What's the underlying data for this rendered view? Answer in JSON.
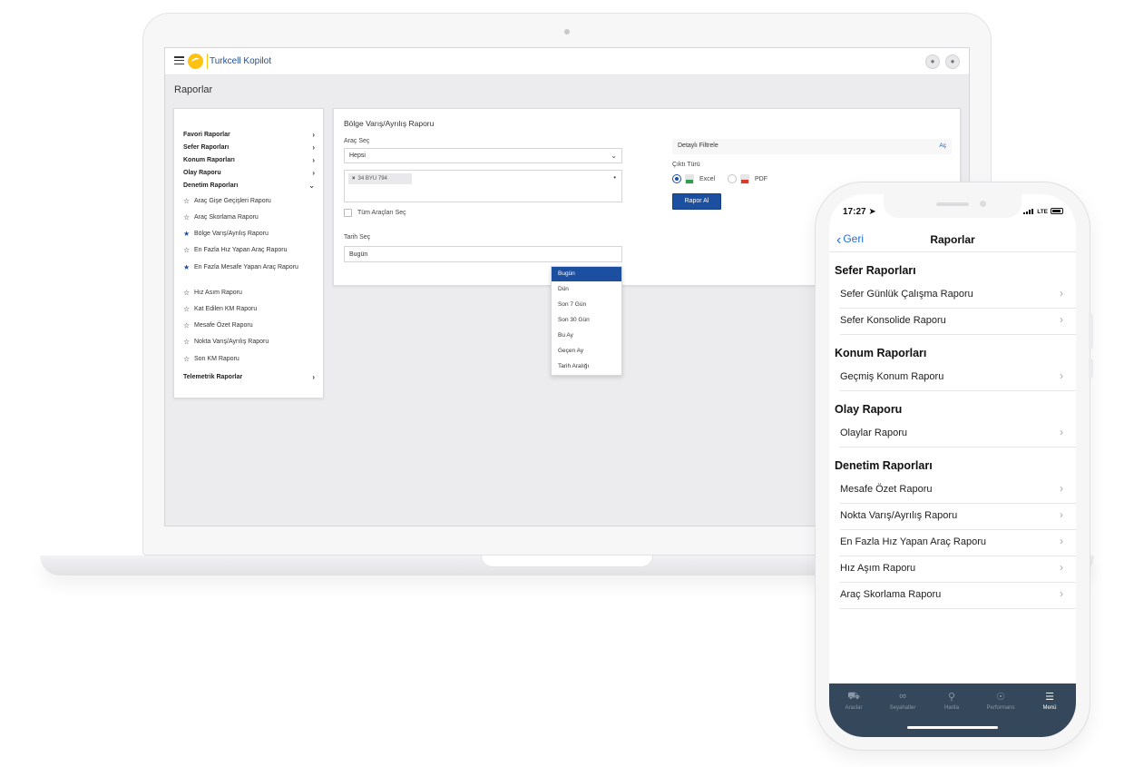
{
  "desktop": {
    "brand": "Turkcell Kopilot",
    "page_title": "Raporlar",
    "sidebar": {
      "categories": [
        {
          "label": "Favori Raporlar"
        },
        {
          "label": "Sefer Raporları"
        },
        {
          "label": "Konum Raporları"
        },
        {
          "label": "Olay Raporu"
        },
        {
          "label": "Denetim Raporları"
        },
        {
          "label": "Telemetrik Raporlar"
        }
      ],
      "denetim_items": [
        {
          "label": "Araç Gişe Geçişleri Raporu",
          "favorite": false
        },
        {
          "label": "Araç Skorlama Raporu",
          "favorite": false
        },
        {
          "label": "Bölge Varış/Ayrılış Raporu",
          "favorite": true
        },
        {
          "label": "En Fazla Hız Yapan Araç Raporu",
          "favorite": false
        },
        {
          "label": "En Fazla Mesafe Yapan Araç Raporu",
          "favorite": true
        },
        {
          "label": "Hız Asım Raporu",
          "favorite": false
        },
        {
          "label": "Kat Edilen KM Raporu",
          "favorite": false
        },
        {
          "label": "Mesafe Özet Raporu",
          "favorite": false
        },
        {
          "label": "Nokta Varış/Ayrılış Raporu",
          "favorite": false
        },
        {
          "label": "Son KM Raporu",
          "favorite": false
        }
      ]
    },
    "form": {
      "title": "Bölge Varış/Ayrılış Raporu",
      "vehicle_label": "Araç Seç",
      "vehicle_value": "Hepsi",
      "tag": "34 BYU 794",
      "select_all_label": "Tüm Araçları Seç",
      "date_label": "Tarih Seç",
      "date_value": "Bugün",
      "filter_label": "Detaylı Filtrele",
      "filter_action": "Aç",
      "output_label": "Çıktı Türü",
      "output_excel": "Excel",
      "output_pdf": "PDF",
      "submit": "Rapor Al"
    },
    "date_options": [
      "Bugün",
      "Dün",
      "Son 7 Gün",
      "Son 30 Gün",
      "Bu Ay",
      "Geçen Ay",
      "Tarih Aralığı"
    ]
  },
  "mobile": {
    "status_time": "17:27",
    "network": "LTE",
    "back_label": "Geri",
    "title": "Raporlar",
    "sections": [
      {
        "title": "Sefer Raporları",
        "items": [
          "Sefer Günlük Çalışma Raporu",
          "Sefer Konsolide Raporu"
        ]
      },
      {
        "title": "Konum Raporları",
        "items": [
          "Geçmiş Konum Raporu"
        ]
      },
      {
        "title": "Olay Raporu",
        "items": [
          "Olaylar Raporu"
        ]
      },
      {
        "title": "Denetim Raporları",
        "items": [
          "Mesafe Özet Raporu",
          "Nokta Varış/Ayrılış Raporu",
          "En Fazla Hız Yapan Araç Raporu",
          "Hız Aşım Raporu",
          "Araç Skorlama Raporu"
        ]
      }
    ],
    "tabs": [
      {
        "label": "Araclar",
        "icon": "truck-icon"
      },
      {
        "label": "Seyahatler",
        "icon": "route-icon"
      },
      {
        "label": "Harita",
        "icon": "map-pin-icon"
      },
      {
        "label": "Performans",
        "icon": "gauge-icon"
      },
      {
        "label": "Menü",
        "icon": "menu-icon"
      }
    ],
    "active_tab": "Menü"
  },
  "colors": {
    "accent": "#1d4fa0",
    "brand_yellow": "#ffc20e",
    "ios_blue": "#1d6fe0",
    "tabbar": "#35475a"
  }
}
